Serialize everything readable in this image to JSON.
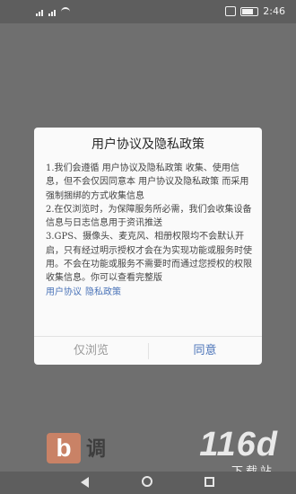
{
  "status_bar": {
    "time": "2:46"
  },
  "dialog": {
    "title": "用户协议及隐私政策",
    "paragraphs": [
      "1.我们会遵循 用户协议及隐私政策 收集、使用信息，但不会仅因同意本 用户协议及隐私政策 而采用强制捆绑的方式收集信息",
      "2.在仅浏览时，为保障服务所必需，我们会收集设备信息与日志信息用于资讯推送",
      "3.GPS、摄像头、麦克风、相册权限均不会默认开启，只有经过明示授权才会在为实现功能或服务时使用。不会在功能或服务不需要时而通过您授权的权限收集信息。你可以查看完整版"
    ],
    "link_user_agreement": "用户协议",
    "link_privacy_policy": "隐私政策",
    "browse_only_button": "仅浏览",
    "agree_button": "同意"
  },
  "background": {
    "logo_letter": "b",
    "logo_text": "调",
    "watermark": "116d",
    "watermark_sub": "下载站"
  },
  "colors": {
    "overlay": "#6f6f6f",
    "link": "#4a73b8",
    "dialog_bg": "#fafafa"
  }
}
